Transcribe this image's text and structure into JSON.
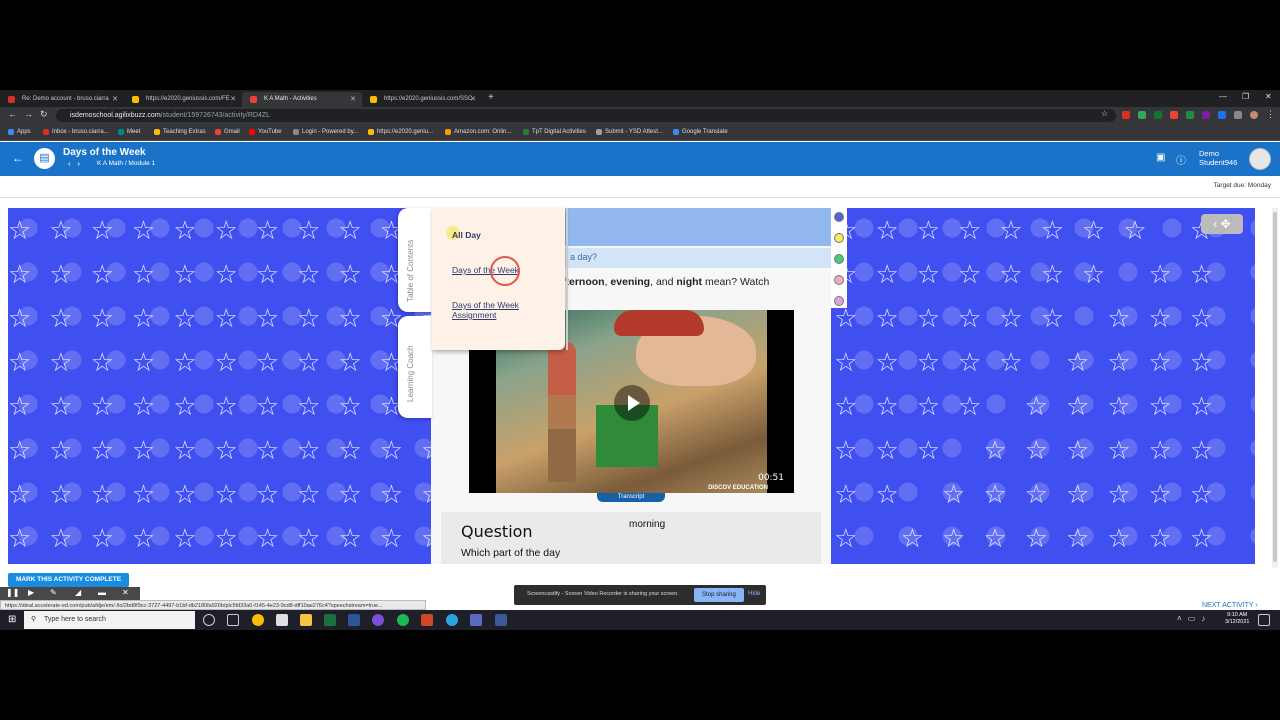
{
  "browser": {
    "tabs": [
      {
        "label": "Re: Demo account - bruso.ciarra",
        "favicon_color": "#d93025"
      },
      {
        "label": "https://e2020.geniussis.com/FE",
        "favicon_color": "#fbbc04"
      },
      {
        "label": "K A Math - Activities",
        "favicon_color": "#ea4335"
      },
      {
        "label": "https://e2020.geniussis.com/SSC",
        "favicon_color": "#fbbc04"
      }
    ],
    "url_host": "isdemoschool.agilixbuzz.com",
    "url_path": "/student/159726743/activity/RD4ZL",
    "bookmarks": [
      {
        "label": "Apps",
        "color": "#4285f4"
      },
      {
        "label": "Inbox - bruso.ciarra...",
        "color": "#d93025"
      },
      {
        "label": "Meet",
        "color": "#00897b"
      },
      {
        "label": "Teaching Extras",
        "color": "#fbbc04"
      },
      {
        "label": "Gmail",
        "color": "#ea4335"
      },
      {
        "label": "YouTube",
        "color": "#ff0000"
      },
      {
        "label": "Login - Powered by...",
        "color": "#888888"
      },
      {
        "label": "https://e2020.geniu...",
        "color": "#fbbc04"
      },
      {
        "label": "Amazon.com: Onlin...",
        "color": "#ff9900"
      },
      {
        "label": "TpT Digital Activities",
        "color": "#2e7d32"
      },
      {
        "label": "Submit - YSD Attest...",
        "color": "#9e9e9e"
      },
      {
        "label": "Google Translate",
        "color": "#4285f4"
      }
    ]
  },
  "app": {
    "title": "Days of the Week",
    "breadcrumb": "K A Math / Module 1",
    "user_first": "Demo",
    "user_second": "Student946",
    "target_due": "Target due: Monday"
  },
  "toc": {
    "side_tab_1": "Table of Contents",
    "side_tab_2": "Learning Coach",
    "items": [
      "All Day",
      "Days of the Week",
      "Days of the Week Assignment"
    ]
  },
  "activity": {
    "question_partial": "a day?",
    "prompt_word_1": "fternoon",
    "prompt_sep_1": ", ",
    "prompt_word_2": "evening",
    "prompt_sep_2": ", and ",
    "prompt_word_3": "night",
    "prompt_rest": " mean? Watch",
    "video_time": "00:51",
    "video_logo": "DISCOV EDUCATION",
    "transcript": "Transcript",
    "question_title": "Question",
    "question_text": "Which part of the day",
    "question_answer": "morning"
  },
  "markers": [
    "#4c66d6",
    "#f3ec5a",
    "#4cc87a",
    "#f3a9c0",
    "#d9a4e6"
  ],
  "footer": {
    "complete_label": "MARK THIS ACTIVITY COMPLETE",
    "next_label": "NEXT ACTIVITY",
    "status_url": "https://ideal.accelerate-ed.com/pub/afdje/em/-/lo/2bd8f9cc-3727-4497-b1bf-db2180fa920b/plc5fd33a0-f145-4e23-9cd8-dff10ae276c4?speechstream=true..."
  },
  "share": {
    "message": "Screencastify - Screen Video Recorder is sharing your screen.",
    "stop_label": "Stop sharing",
    "hide_label": "Hide"
  },
  "taskbar": {
    "search_placeholder": "Type here to search",
    "time": "9:10 AM",
    "date": "3/12/2021"
  }
}
